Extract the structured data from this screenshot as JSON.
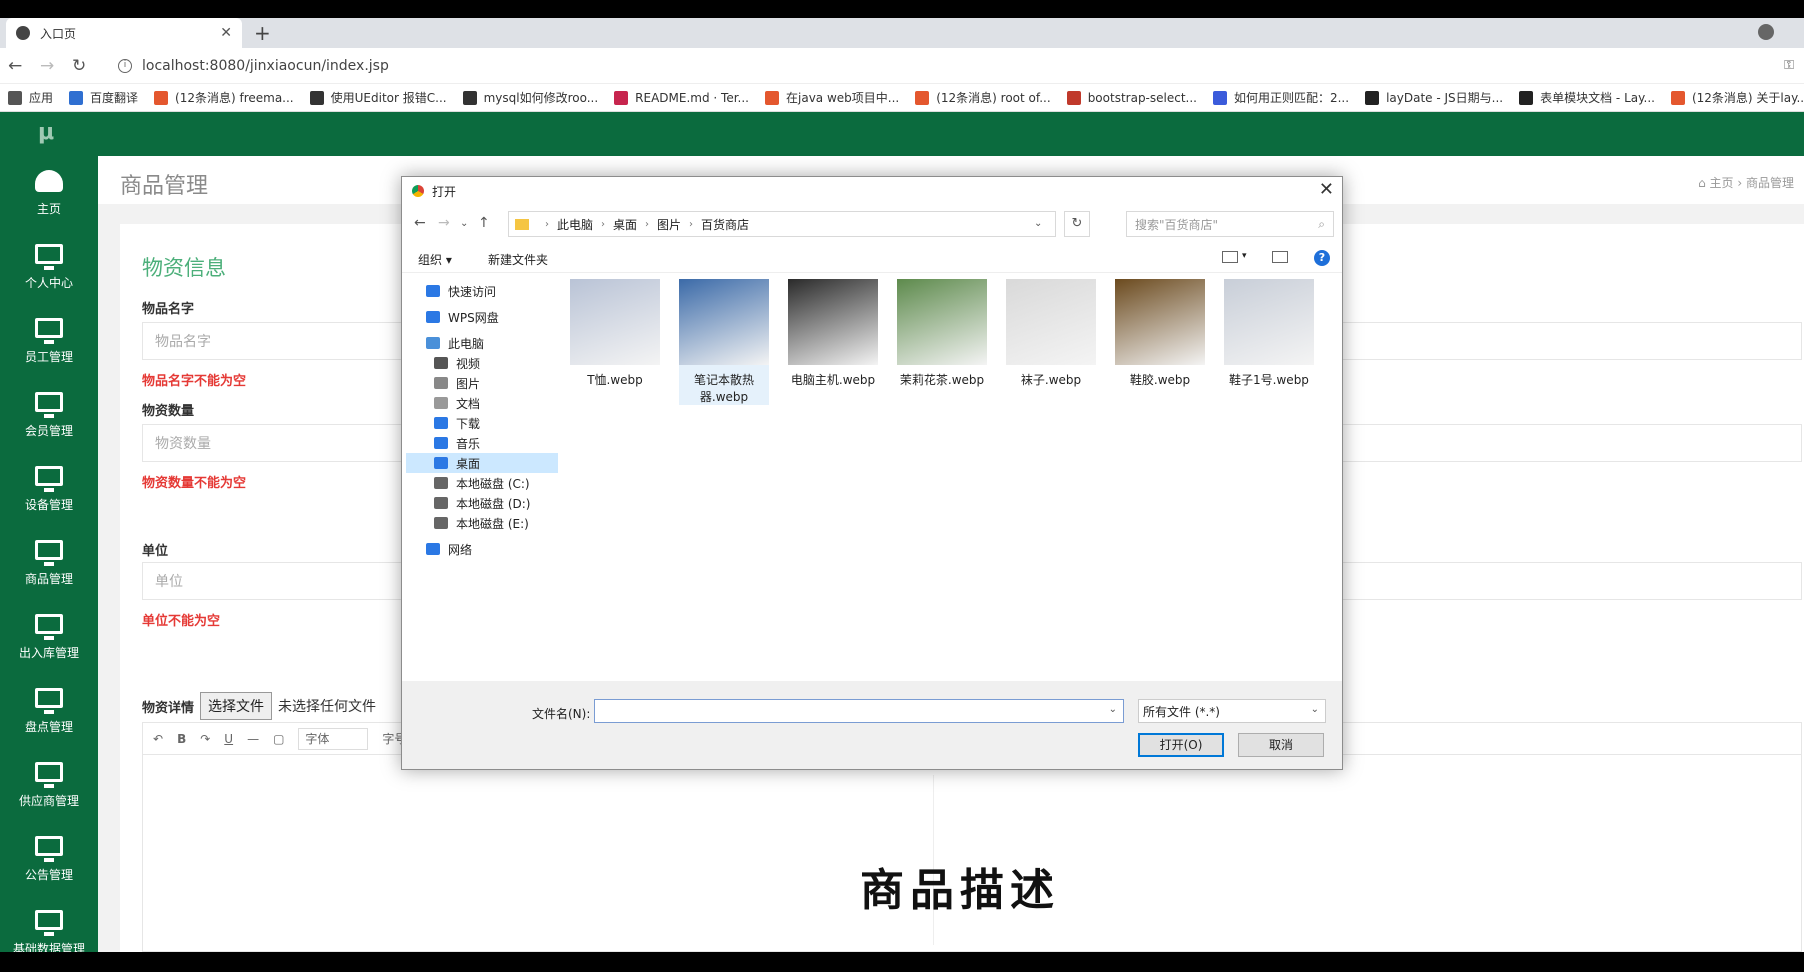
{
  "browser": {
    "tab_title": "入口页",
    "url": "localhost:8080/jinxiaocun/index.jsp",
    "bookmarks": [
      {
        "label": "应用",
        "color": "#555555"
      },
      {
        "label": "百度翻译",
        "color": "#2f6fd1"
      },
      {
        "label": "(12条消息) freema...",
        "color": "#e4572e"
      },
      {
        "label": "使用UEditor 报错C...",
        "color": "#333333"
      },
      {
        "label": "mysql如何修改roo...",
        "color": "#333333"
      },
      {
        "label": "README.md · Ter...",
        "color": "#c7254e"
      },
      {
        "label": "在java web项目中...",
        "color": "#e4572e"
      },
      {
        "label": "(12条消息) root of...",
        "color": "#e4572e"
      },
      {
        "label": "bootstrap-select...",
        "color": "#c0392b"
      },
      {
        "label": "如何用正则匹配：2...",
        "color": "#3b5bdb"
      },
      {
        "label": "layDate - JS日期与...",
        "color": "#222222"
      },
      {
        "label": "表单模块文档 - Lay...",
        "color": "#222222"
      },
      {
        "label": "(12条消息) 关于lay...",
        "color": "#e4572e"
      }
    ]
  },
  "app": {
    "logo": "μ",
    "sidebar": [
      {
        "label": "主页",
        "icon": "dashboard-icon"
      },
      {
        "label": "个人中心",
        "icon": "monitor-icon"
      },
      {
        "label": "员工管理",
        "icon": "monitor-icon"
      },
      {
        "label": "会员管理",
        "icon": "monitor-icon"
      },
      {
        "label": "设备管理",
        "icon": "monitor-icon"
      },
      {
        "label": "商品管理",
        "icon": "monitor-icon"
      },
      {
        "label": "出入库管理",
        "icon": "monitor-icon"
      },
      {
        "label": "盘点管理",
        "icon": "monitor-icon"
      },
      {
        "label": "供应商管理",
        "icon": "monitor-icon"
      },
      {
        "label": "公告管理",
        "icon": "monitor-icon"
      },
      {
        "label": "基础数据管理",
        "icon": "monitor-icon"
      }
    ],
    "page_title": "商品管理",
    "breadcrumb": {
      "home": "主页",
      "current": "商品管理"
    },
    "form": {
      "section_title": "物资信息",
      "name_label": "物品名字",
      "name_placeholder": "物品名字",
      "name_error": "物品名字不能为空",
      "qty_label": "物资数量",
      "qty_placeholder": "物资数量",
      "qty_error": "物资数量不能为空",
      "unit_label": "单位",
      "unit_placeholder": "单位",
      "unit_error": "单位不能为空",
      "detail_label": "物资详情",
      "choose_file": "选择文件",
      "no_file": "未选择任何文件",
      "editor_font": "字体",
      "editor_size": "字号",
      "editor_content": "商品描述"
    }
  },
  "dialog": {
    "title": "打开",
    "path": [
      "此电脑",
      "桌面",
      "图片",
      "百货商店"
    ],
    "search_placeholder": "搜索\"百货商店\"",
    "organize": "组织",
    "new_folder": "新建文件夹",
    "tree": [
      {
        "label": "快速访问",
        "color": "#2b78e4"
      },
      {
        "label": "WPS网盘",
        "color": "#2b78e4"
      },
      {
        "label": "此电脑",
        "color": "#4a90d9"
      },
      {
        "label": "视频",
        "color": "#555555"
      },
      {
        "label": "图片",
        "color": "#888888"
      },
      {
        "label": "文档",
        "color": "#999999"
      },
      {
        "label": "下载",
        "color": "#2b78e4"
      },
      {
        "label": "音乐",
        "color": "#2b78e4"
      },
      {
        "label": "桌面",
        "color": "#2b78e4"
      },
      {
        "label": "本地磁盘 (C:)",
        "color": "#666666"
      },
      {
        "label": "本地磁盘 (D:)",
        "color": "#666666"
      },
      {
        "label": "本地磁盘 (E:)",
        "color": "#666666"
      },
      {
        "label": "网络",
        "color": "#2b78e4"
      }
    ],
    "files": [
      {
        "name": "T恤.webp",
        "color": "#b9c3d6"
      },
      {
        "name": "笔记本散热器.webp",
        "color": "#3b6aa8"
      },
      {
        "name": "电脑主机.webp",
        "color": "#2a2a2a"
      },
      {
        "name": "茉莉花茶.webp",
        "color": "#5d8a4c"
      },
      {
        "name": "袜子.webp",
        "color": "#d9d9d9"
      },
      {
        "name": "鞋胶.webp",
        "color": "#6b4a1e"
      },
      {
        "name": "鞋子1号.webp",
        "color": "#c8ced8"
      }
    ],
    "filename_label": "文件名(N):",
    "filetype": "所有文件 (*.*)",
    "open_button": "打开(O)",
    "cancel_button": "取消"
  }
}
